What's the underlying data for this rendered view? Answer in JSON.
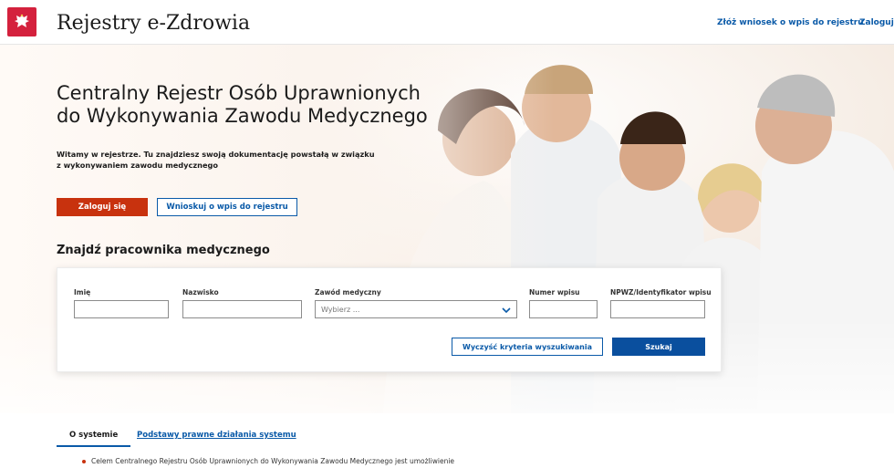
{
  "header": {
    "brand": "Rejestry e-Zdrowia",
    "link_apply": "Złóż wniosek o wpis do rejestru",
    "link_login": "Zaloguj się",
    "emblem_icon": "eagle-emblem-icon"
  },
  "hero": {
    "title_line1": "Centralny Rejestr Osób Uprawnionych",
    "title_line2": "do Wykonywania Zawodu Medycznego",
    "intro_line1": "Witamy w rejestrze. Tu znajdziesz swoją dokumentację powstałą w związku",
    "intro_line2": "z wykonywaniem zawodu medycznego",
    "login_button": "Zaloguj się",
    "apply_button": "Wnioskuj o wpis do rejestru"
  },
  "search": {
    "title": "Znajdź pracownika medycznego",
    "fields": {
      "first_name_label": "Imię",
      "last_name_label": "Nazwisko",
      "profession_label": "Zawód medyczny",
      "profession_placeholder": "Wybierz ...",
      "entry_number_label": "Numer wpisu",
      "npwz_label": "NPWZ/Identyfikator wpisu"
    },
    "clear_button": "Wyczyść kryteria wyszukiwania",
    "search_button": "Szukaj"
  },
  "tabs": [
    {
      "label": "O systemie",
      "active": true
    },
    {
      "label": "Podstawy prawne działania systemu",
      "active": false
    }
  ],
  "content": {
    "first_bullet": "Celem Centralnego Rejestru Osób Uprawnionych do Wykonywania Zawodu Medycznego jest umożliwienie"
  },
  "colors": {
    "accent_red": "#c8320e",
    "link_blue": "#0a5aa8",
    "search_blue": "#0a4f9e",
    "emblem_red": "#d4213d"
  }
}
